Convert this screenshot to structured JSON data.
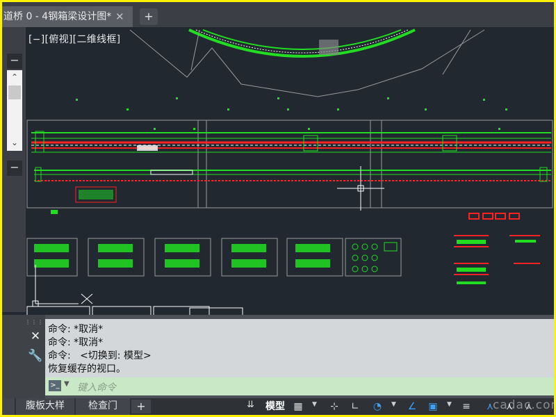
{
  "window": {
    "tab_title": "道桥 0 - 4钢箱梁设计图*",
    "tab_close": "✕",
    "new_tab": "+"
  },
  "palette": {
    "collapse_top": "−",
    "collapse_mid": "−",
    "collapse_cmd": "−",
    "scroll_up": "⌃",
    "scroll_down": "⌄"
  },
  "viewport": {
    "label": "[−][俯视][二维线框]"
  },
  "command": {
    "history": [
      "命令: *取消*",
      "命令: *取消*",
      "命令:   <切换到: 模型>",
      "恢复缓存的视口。"
    ],
    "placeholder": "键入命令",
    "close_icon": "✕",
    "settings_icon": "🔧"
  },
  "layout_tabs": {
    "items": [
      "腹板大样",
      "检查门"
    ],
    "add": "+",
    "menu_icon": "⇊"
  },
  "status": {
    "model_label": "模型",
    "watermark": "cadac.com"
  },
  "colors": {
    "canvas": "#212830",
    "drawing_green": "#22dd22",
    "drawing_red": "#ff2222",
    "frame_accent": "#fff200"
  }
}
